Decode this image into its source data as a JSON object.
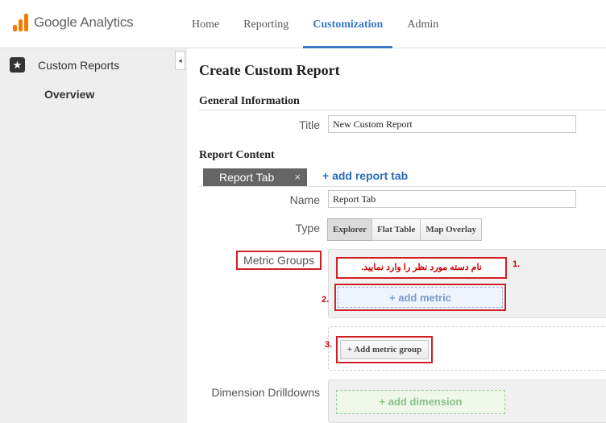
{
  "app": {
    "name": "Google Analytics"
  },
  "nav": {
    "items": [
      {
        "label": "Home"
      },
      {
        "label": "Reporting"
      },
      {
        "label": "Customization"
      },
      {
        "label": "Admin"
      }
    ],
    "active": "Customization"
  },
  "sidebar": {
    "section_label": "Custom Reports",
    "sub_item": "Overview",
    "collapse_glyph": "◂"
  },
  "main": {
    "title": "Create Custom Report",
    "general": {
      "heading": "General Information",
      "title_label": "Title",
      "title_value": "New Custom Report"
    },
    "content": {
      "heading": "Report Content",
      "tab_label": "Report Tab",
      "tab_close": "×",
      "add_tab": "+ add report tab",
      "name_label": "Name",
      "name_value": "Report Tab",
      "type_label": "Type",
      "types": [
        "Explorer",
        "Flat Table",
        "Map Overlay"
      ],
      "selected_type": "Explorer",
      "metric_groups_label": "Metric Groups",
      "group_name_hint": "نام دسته مورد نظر را وارد نمایید.",
      "add_metric": "+ add metric",
      "add_metric_group": "+ Add metric group",
      "dimension_label": "Dimension Drilldowns",
      "add_dimension": "+ add dimension"
    },
    "annotations": {
      "step1": "1.",
      "step2": "2.",
      "step3": "3.",
      "color": "#d11f26"
    }
  },
  "colors": {
    "accent": "#3a78c3",
    "logo": "#f57c00",
    "annotation": "#d11f26"
  }
}
